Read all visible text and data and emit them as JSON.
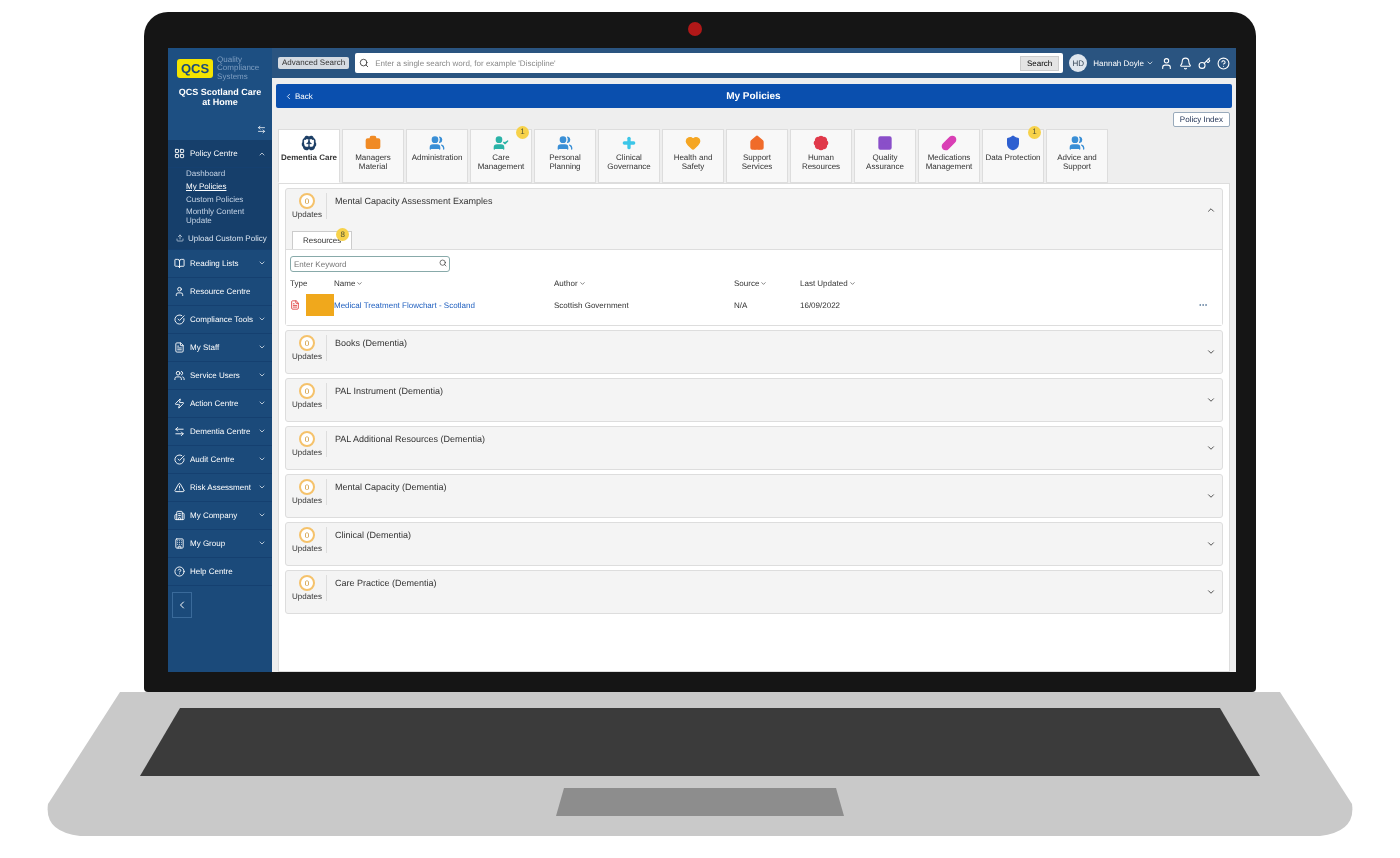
{
  "sidebar": {
    "logo": "QCS",
    "logo_tagline": "Quality Compliance Systems",
    "company": "QCS Scotland Care at Home",
    "items": [
      {
        "label": "Policy Centre",
        "expandable": true,
        "expanded": true,
        "children": [
          {
            "label": "Dashboard",
            "selected": false
          },
          {
            "label": "My Policies",
            "selected": true
          },
          {
            "label": "Custom Policies",
            "selected": false
          },
          {
            "label": "Monthly Content Update",
            "selected": false
          }
        ],
        "extra": "Upload Custom Policy"
      },
      {
        "label": "Reading Lists",
        "expandable": true,
        "expanded": false
      },
      {
        "label": "Resource Centre",
        "expandable": false,
        "expanded": false
      },
      {
        "label": "Compliance Tools",
        "expandable": true,
        "expanded": false
      },
      {
        "label": "My Staff",
        "expandable": true,
        "expanded": false
      },
      {
        "label": "Service Users",
        "expandable": true,
        "expanded": false
      },
      {
        "label": "Action Centre",
        "expandable": true,
        "expanded": false
      },
      {
        "label": "Dementia Centre",
        "expandable": true,
        "expanded": false
      },
      {
        "label": "Audit Centre",
        "expandable": true,
        "expanded": false
      },
      {
        "label": "Risk Assessment",
        "expandable": true,
        "expanded": false
      },
      {
        "label": "My Company",
        "expandable": true,
        "expanded": false
      },
      {
        "label": "My Group",
        "expandable": true,
        "expanded": false
      },
      {
        "label": "Help Centre",
        "expandable": false,
        "expanded": false
      }
    ]
  },
  "topbar": {
    "advanced_search": "Advanced Search",
    "search_placeholder": "Enter a single search word, for example 'Discipline'",
    "search_button": "Search",
    "avatar": "HD",
    "user": "Hannah Doyle"
  },
  "header": {
    "back": "Back",
    "title": "My Policies",
    "policy_index": "Policy Index"
  },
  "tabs": [
    {
      "label": "Dementia Care",
      "selected": true,
      "color": "#1d3f66"
    },
    {
      "label": "Managers Material",
      "selected": false,
      "color": "#f08a24"
    },
    {
      "label": "Administration",
      "selected": false,
      "color": "#3a8fd6"
    },
    {
      "label": "Care Management",
      "selected": false,
      "color": "#2bb3a8",
      "badge": "1"
    },
    {
      "label": "Personal Planning",
      "selected": false,
      "color": "#3a8fd6"
    },
    {
      "label": "Clinical Governance",
      "selected": false,
      "color": "#3cc6e8"
    },
    {
      "label": "Health and Safety",
      "selected": false,
      "color": "#f5a623"
    },
    {
      "label": "Support Services",
      "selected": false,
      "color": "#f06b2a"
    },
    {
      "label": "Human Resources",
      "selected": false,
      "color": "#e0394a"
    },
    {
      "label": "Quality Assurance",
      "selected": false,
      "color": "#8a4fc9"
    },
    {
      "label": "Medications Management",
      "selected": false,
      "color": "#d93fb5"
    },
    {
      "label": "Data Protection",
      "selected": false,
      "color": "#2d5fd0",
      "badge": "1"
    },
    {
      "label": "Advice and Support",
      "selected": false,
      "color": "#3a8fd6"
    }
  ],
  "sections": [
    {
      "title": "Mental Capacity Assessment Examples",
      "updates_count": "0",
      "updates_label": "Updates",
      "expanded": true,
      "resources_tab": {
        "label": "Resources",
        "badge": "8"
      },
      "keyword_placeholder": "Enter Keyword",
      "table": {
        "columns": [
          {
            "label": "Type",
            "sortable": false
          },
          {
            "label": "Name",
            "sortable": true
          },
          {
            "label": "Author",
            "sortable": true
          },
          {
            "label": "Source",
            "sortable": true
          },
          {
            "label": "Last Updated",
            "sortable": true
          }
        ],
        "rows": [
          {
            "name": "Medical Treatment Flowchart - Scotland",
            "author": "Scottish Government",
            "source": "N/A",
            "updated": "16/09/2022"
          }
        ]
      }
    },
    {
      "title": "Books (Dementia)",
      "updates_count": "0",
      "updates_label": "Updates",
      "expanded": false
    },
    {
      "title": "PAL Instrument (Dementia)",
      "updates_count": "0",
      "updates_label": "Updates",
      "expanded": false
    },
    {
      "title": "PAL Additional Resources (Dementia)",
      "updates_count": "0",
      "updates_label": "Updates",
      "expanded": false
    },
    {
      "title": "Mental Capacity (Dementia)",
      "updates_count": "0",
      "updates_label": "Updates",
      "expanded": false
    },
    {
      "title": "Clinical (Dementia)",
      "updates_count": "0",
      "updates_label": "Updates",
      "expanded": false
    },
    {
      "title": "Care Practice (Dementia)",
      "updates_count": "0",
      "updates_label": "Updates",
      "expanded": false
    }
  ]
}
